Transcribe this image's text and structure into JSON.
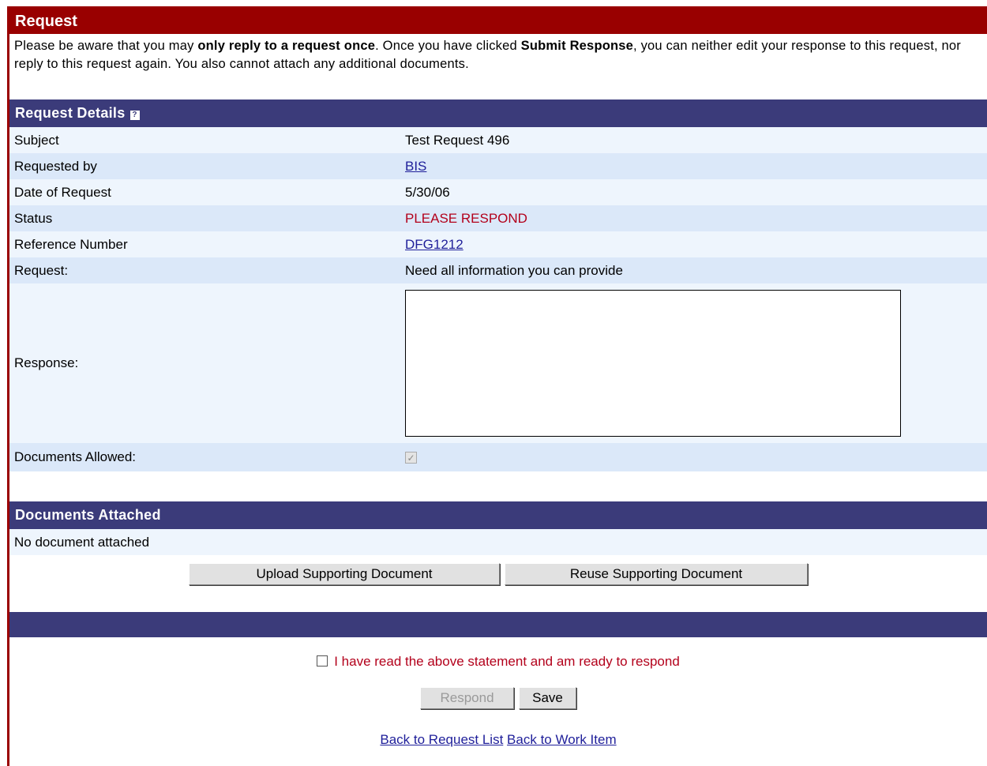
{
  "page": {
    "title": "Request",
    "notice": {
      "t1": "Please be aware that you may ",
      "b1": "only reply to a request once",
      "t2": ". Once you have clicked ",
      "b2": "Submit Response",
      "t3": ", you can neither edit your response to this request, nor reply to this request again. You also cannot attach any additional documents."
    }
  },
  "details": {
    "header": "Request Details",
    "help_icon_glyph": "?",
    "rows": {
      "subject": {
        "label": "Subject",
        "value": "Test Request 496"
      },
      "requested_by": {
        "label": "Requested by",
        "value": "BIS"
      },
      "date": {
        "label": "Date of Request",
        "value": "5/30/06"
      },
      "status": {
        "label": "Status",
        "value": "PLEASE RESPOND"
      },
      "reference": {
        "label": "Reference Number",
        "value": "DFG1212"
      },
      "request": {
        "label": "Request:",
        "value": "Need all information you can provide"
      },
      "response": {
        "label": "Response:",
        "value": ""
      },
      "docs_allowed": {
        "label": "Documents Allowed:",
        "checked": true
      }
    },
    "colors": {
      "header_bg": "#3b3b7a",
      "row_alt": "#dbe8f9",
      "row_light": "#eef5fd",
      "status": "#b3001b"
    }
  },
  "documents": {
    "header": "Documents Attached",
    "empty_text": "No document attached",
    "upload_label": "Upload Supporting Document",
    "reuse_label": "Reuse Supporting Document"
  },
  "confirm": {
    "text": "I have read the above statement and am ready to respond",
    "checked": false
  },
  "actions": {
    "respond_label": "Respond",
    "save_label": "Save"
  },
  "links": {
    "back_request_list": "Back to Request List",
    "back_work_item": "Back to Work Item"
  },
  "theme": {
    "title_bg": "#990000"
  }
}
